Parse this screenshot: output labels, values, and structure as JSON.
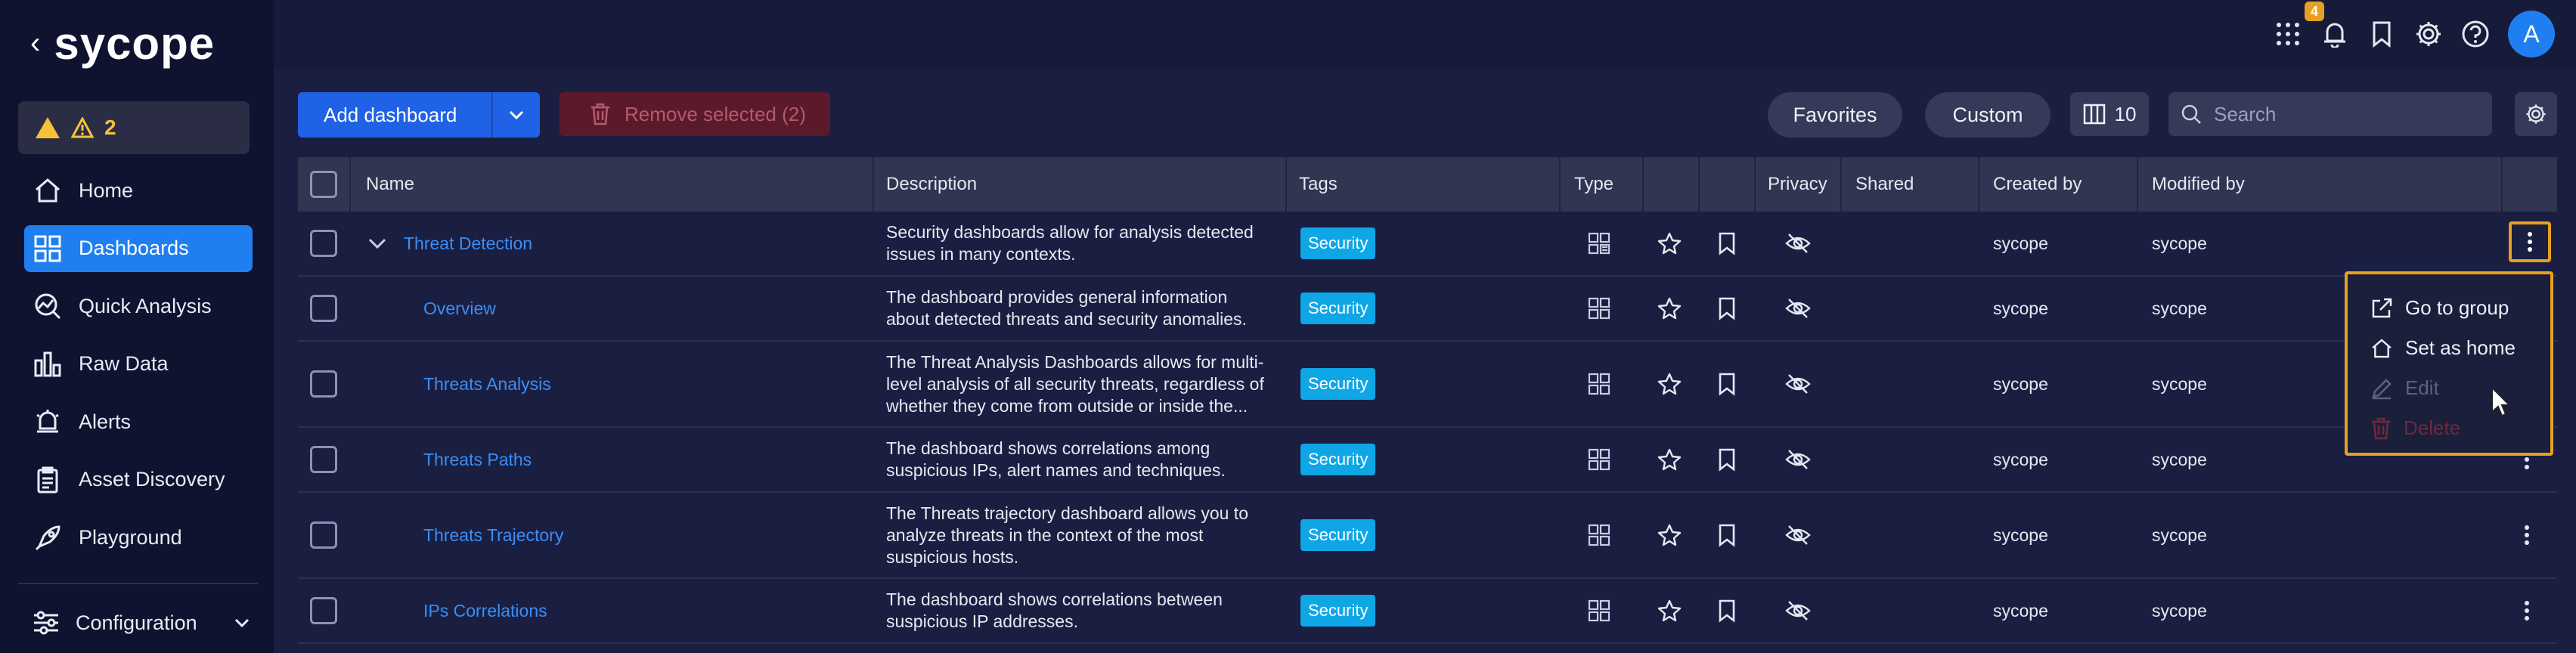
{
  "brand": {
    "name": "sycope"
  },
  "sidebar": {
    "alert_count": "2",
    "items": [
      {
        "label": "Home",
        "icon": "home-icon"
      },
      {
        "label": "Dashboards",
        "icon": "dashboards-icon"
      },
      {
        "label": "Quick Analysis",
        "icon": "quick-analysis-icon"
      },
      {
        "label": "Raw Data",
        "icon": "raw-data-icon"
      },
      {
        "label": "Alerts",
        "icon": "alerts-icon"
      },
      {
        "label": "Asset Discovery",
        "icon": "asset-discovery-icon"
      },
      {
        "label": "Playground",
        "icon": "playground-icon"
      }
    ],
    "config_label": "Configuration"
  },
  "topbar": {
    "notification_badge": "4",
    "avatar_letter": "A"
  },
  "toolbar": {
    "add_label": "Add dashboard",
    "remove_label": "Remove selected (2)",
    "favorites_label": "Favorites",
    "custom_label": "Custom",
    "column_count": "10",
    "search_placeholder": "Search"
  },
  "table": {
    "columns": {
      "name": "Name",
      "description": "Description",
      "tags": "Tags",
      "type": "Type",
      "privacy": "Privacy",
      "shared": "Shared",
      "created_by": "Created by",
      "modified_by": "Modified by"
    },
    "rows": [
      {
        "name": "Threat Detection",
        "description": "Security dashboards allow for analysis detected issues in many contexts.",
        "tag": "Security",
        "created_by": "sycope",
        "modified_by": "sycope"
      },
      {
        "name": "Overview",
        "description": "The dashboard provides general information about detected threats and security anomalies.",
        "tag": "Security",
        "created_by": "sycope",
        "modified_by": "sycope"
      },
      {
        "name": "Threats Analysis",
        "description": "The Threat Analysis Dashboards allows for multi-level analysis of all security threats, regardless of whether they come from outside or inside the...",
        "tag": "Security",
        "created_by": "sycope",
        "modified_by": "sycope"
      },
      {
        "name": "Threats Paths",
        "description": "The dashboard shows correlations among suspicious IPs, alert names and techniques.",
        "tag": "Security",
        "created_by": "sycope",
        "modified_by": "sycope"
      },
      {
        "name": "Threats Trajectory",
        "description": "The Threats trajectory dashboard allows you to analyze threats in the context of the most suspicious hosts.",
        "tag": "Security",
        "created_by": "sycope",
        "modified_by": "sycope"
      },
      {
        "name": "IPs Correlations",
        "description": "The dashboard shows correlations between suspicious IP addresses.",
        "tag": "Security",
        "created_by": "sycope",
        "modified_by": "sycope"
      }
    ]
  },
  "context_menu": {
    "items": [
      {
        "label": "Go to group",
        "icon": "external-link-icon",
        "disabled": false
      },
      {
        "label": "Set as home",
        "icon": "home-icon",
        "disabled": false
      },
      {
        "label": "Edit",
        "icon": "pencil-icon",
        "disabled": true
      },
      {
        "label": "Delete",
        "icon": "trash-icon",
        "disabled": true
      }
    ]
  },
  "colors": {
    "accent": "#1f7ff0",
    "primary_button": "#2062e6",
    "tag": "#0fa6e6",
    "highlight": "#e7a020",
    "warning": "#f5c23a"
  }
}
